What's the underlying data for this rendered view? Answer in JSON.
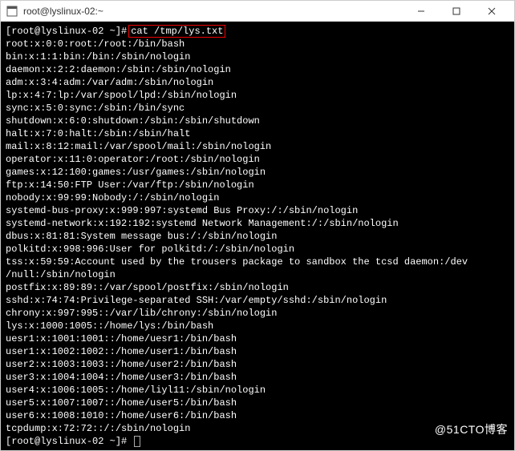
{
  "titlebar": {
    "title": "root@lyslinux-02:~",
    "icon": "terminal-icon"
  },
  "terminal": {
    "prompt": "[root@lyslinux-02 ~]#",
    "command": "cat /tmp/lys.txt",
    "output_lines": [
      "root:x:0:0:root:/root:/bin/bash",
      "bin:x:1:1:bin:/bin:/sbin/nologin",
      "daemon:x:2:2:daemon:/sbin:/sbin/nologin",
      "adm:x:3:4:adm:/var/adm:/sbin/nologin",
      "lp:x:4:7:lp:/var/spool/lpd:/sbin/nologin",
      "sync:x:5:0:sync:/sbin:/bin/sync",
      "shutdown:x:6:0:shutdown:/sbin:/sbin/shutdown",
      "halt:x:7:0:halt:/sbin:/sbin/halt",
      "mail:x:8:12:mail:/var/spool/mail:/sbin/nologin",
      "operator:x:11:0:operator:/root:/sbin/nologin",
      "games:x:12:100:games:/usr/games:/sbin/nologin",
      "ftp:x:14:50:FTP User:/var/ftp:/sbin/nologin",
      "nobody:x:99:99:Nobody:/:/sbin/nologin",
      "systemd-bus-proxy:x:999:997:systemd Bus Proxy:/:/sbin/nologin",
      "systemd-network:x:192:192:systemd Network Management:/:/sbin/nologin",
      "dbus:x:81:81:System message bus:/:/sbin/nologin",
      "polkitd:x:998:996:User for polkitd:/:/sbin/nologin",
      "tss:x:59:59:Account used by the trousers package to sandbox the tcsd daemon:/dev",
      "/null:/sbin/nologin",
      "postfix:x:89:89::/var/spool/postfix:/sbin/nologin",
      "sshd:x:74:74:Privilege-separated SSH:/var/empty/sshd:/sbin/nologin",
      "chrony:x:997:995::/var/lib/chrony:/sbin/nologin",
      "lys:x:1000:1005::/home/lys:/bin/bash",
      "uesr1:x:1001:1001::/home/uesr1:/bin/bash",
      "user1:x:1002:1002::/home/user1:/bin/bash",
      "user2:x:1003:1003::/home/user2:/bin/bash",
      "user3:x:1004:1004::/home/user3:/bin/bash",
      "user4:x:1006:1005::/home/liyl11:/sbin/nologin",
      "user5:x:1007:1007::/home/user5:/bin/bash",
      "user6:x:1008:1010::/home/user6:/bin/bash",
      "tcpdump:x:72:72::/:/sbin/nologin"
    ],
    "prompt2": "[root@lyslinux-02 ~]#"
  },
  "watermark": "@51CTO博客"
}
